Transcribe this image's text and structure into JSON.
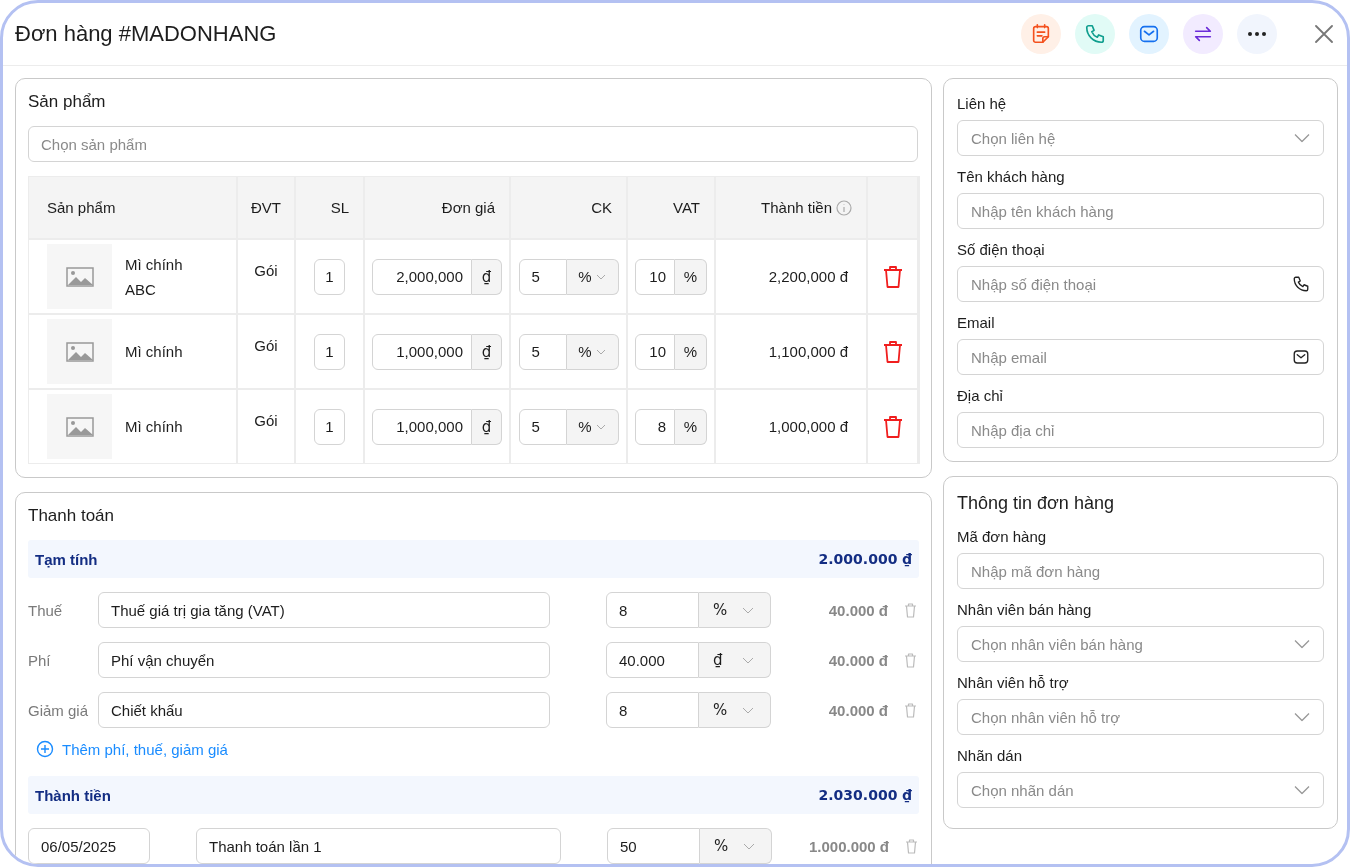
{
  "window": {
    "title": "Đơn hàng #MADONHANG"
  },
  "products": {
    "title": "Sản phẩm",
    "search": {
      "placeholder": "Chọn sản phẩm"
    },
    "columns": [
      {
        "label": "Sản phẩm"
      },
      {
        "label": "ĐVT"
      },
      {
        "label": "SL"
      },
      {
        "label": "Đơn giá"
      },
      {
        "label": "CK"
      },
      {
        "label": "VAT"
      },
      {
        "label": "Thành tiền"
      }
    ],
    "rows": [
      {
        "name": "Mì chính ABC",
        "unit": "Gói",
        "qty": "1",
        "price": "2,000,000",
        "currency": "₫",
        "discount": "5",
        "discount_unit": "%",
        "vat": "10",
        "vat_unit": "%",
        "total": "2,200,000 đ"
      },
      {
        "name": "Mì chính",
        "unit": "Gói",
        "qty": "1",
        "price": "1,000,000",
        "currency": "₫",
        "discount": "5",
        "discount_unit": "%",
        "vat": "10",
        "vat_unit": "%",
        "total": "1,100,000 đ"
      },
      {
        "name": "Mì chính",
        "unit": "Gói",
        "qty": "1",
        "price": "1,000,000",
        "currency": "₫",
        "discount": "5",
        "discount_unit": "%",
        "vat": "8",
        "vat_unit": "%",
        "total": "1,000,000 đ"
      }
    ]
  },
  "payment": {
    "title": "Thanh toán",
    "subtotal": {
      "label": "Tạm tính",
      "value": "2.000.000 ₫"
    },
    "adjustments": [
      {
        "label": "Thuế",
        "name": "Thuế giá trị gia tăng (VAT)",
        "value": "8",
        "unit": "%",
        "amount": "40.000 đ"
      },
      {
        "label": "Phí",
        "name": "Phí vận chuyển",
        "value": "40.000",
        "unit": "₫",
        "amount": "40.000 đ"
      },
      {
        "label": "Giảm giá",
        "name": "Chiết khấu",
        "value": "8",
        "unit": "%",
        "amount": "40.000 đ"
      }
    ],
    "add_link": "Thêm phí, thuế, giảm giá",
    "total": {
      "label": "Thành tiền",
      "value": "2.030.000 ₫"
    },
    "installments": [
      {
        "date": "06/05/2025",
        "name": "Thanh toán lần 1",
        "value": "50",
        "unit": "%",
        "amount": "1.000.000 đ"
      }
    ]
  },
  "customer": {
    "fields": [
      {
        "label": "Liên hệ",
        "placeholder": "Chọn liên hệ",
        "kind": "select"
      },
      {
        "label": "Tên khách hàng",
        "placeholder": "Nhập tên khách hàng",
        "kind": "text"
      },
      {
        "label": "Số điện thoại",
        "placeholder": "Nhập số điện thoại",
        "kind": "phone"
      },
      {
        "label": "Email",
        "placeholder": "Nhập email",
        "kind": "email"
      },
      {
        "label": "Địa chỉ",
        "placeholder": "Nhập địa chỉ",
        "kind": "text"
      }
    ]
  },
  "order_info": {
    "title": "Thông tin đơn hàng",
    "fields": [
      {
        "label": "Mã đơn hàng",
        "placeholder": "Nhập mã đơn hàng",
        "kind": "text"
      },
      {
        "label": "Nhân viên bán hàng",
        "placeholder": "Chọn nhân viên bán hàng",
        "kind": "select"
      },
      {
        "label": "Nhân viên hỗ trợ",
        "placeholder": "Chọn nhân viên hỗ trợ",
        "kind": "select"
      },
      {
        "label": "Nhãn dán",
        "placeholder": "Chọn nhãn dán",
        "kind": "select"
      }
    ]
  }
}
